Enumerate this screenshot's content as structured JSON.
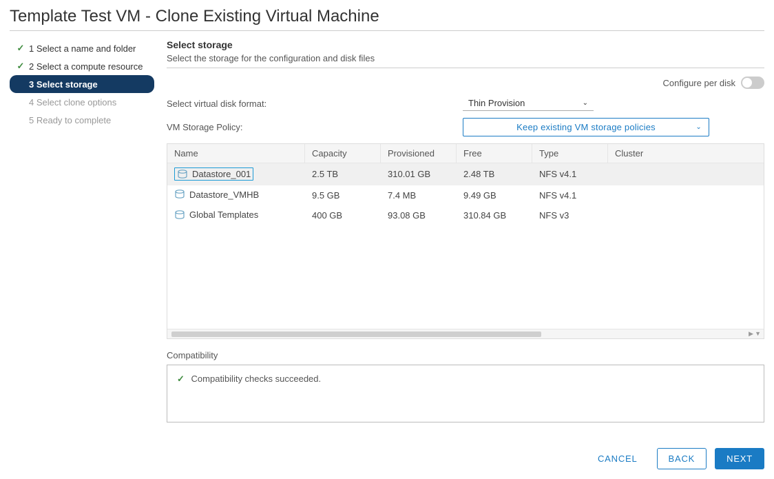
{
  "title": "Template Test VM - Clone Existing Virtual Machine",
  "sidebar": {
    "steps": [
      {
        "label": "1 Select a name and folder",
        "status": "done"
      },
      {
        "label": "2 Select a compute resource",
        "status": "done"
      },
      {
        "label": "3 Select storage",
        "status": "active"
      },
      {
        "label": "4 Select clone options",
        "status": "future"
      },
      {
        "label": "5 Ready to complete",
        "status": "future"
      }
    ]
  },
  "main": {
    "heading": "Select storage",
    "subtext": "Select the storage for the configuration and disk files",
    "configure_per_disk_label": "Configure per disk",
    "configure_per_disk_on": false,
    "disk_format_label": "Select virtual disk format:",
    "disk_format_value": "Thin Provision",
    "policy_label": "VM Storage Policy:",
    "policy_value": "Keep existing VM storage policies",
    "columns": {
      "name": "Name",
      "capacity": "Capacity",
      "provisioned": "Provisioned",
      "free": "Free",
      "type": "Type",
      "cluster": "Cluster"
    },
    "datastores": [
      {
        "name": "Datastore_001",
        "capacity": "2.5 TB",
        "provisioned": "310.01 GB",
        "free": "2.48 TB",
        "type": "NFS v4.1",
        "cluster": "",
        "selected": true
      },
      {
        "name": "Datastore_VMHB",
        "capacity": "9.5 GB",
        "provisioned": "7.4 MB",
        "free": "9.49 GB",
        "type": "NFS v4.1",
        "cluster": "",
        "selected": false
      },
      {
        "name": "Global Templates",
        "capacity": "400 GB",
        "provisioned": "93.08 GB",
        "free": "310.84 GB",
        "type": "NFS v3",
        "cluster": "",
        "selected": false
      }
    ],
    "compat_label": "Compatibility",
    "compat_msg": "Compatibility checks succeeded."
  },
  "footer": {
    "cancel": "CANCEL",
    "back": "BACK",
    "next": "NEXT"
  }
}
